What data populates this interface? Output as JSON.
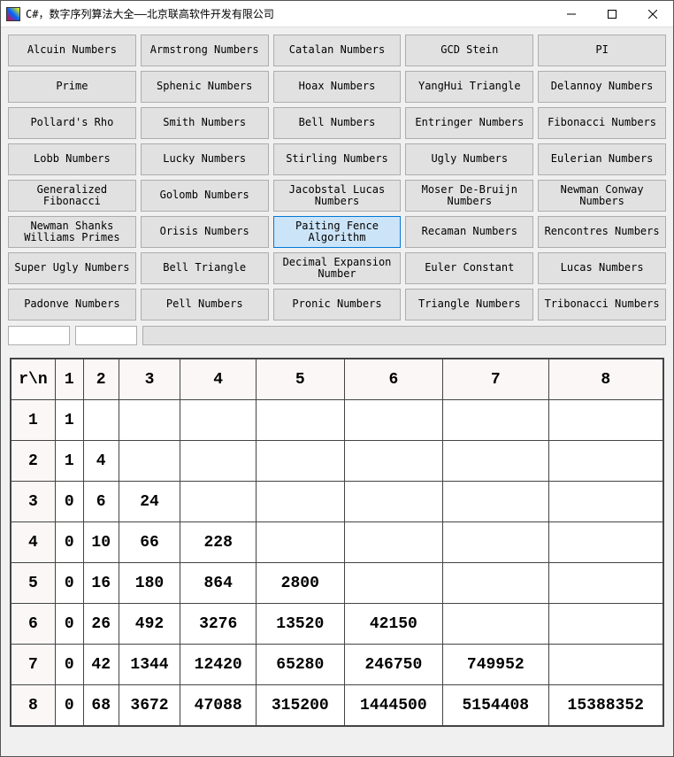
{
  "window": {
    "title": "C#，数字序列算法大全——北京联高软件开发有限公司"
  },
  "buttons": [
    "Alcuin Numbers",
    "Armstrong Numbers",
    "Catalan Numbers",
    "GCD Stein",
    "PI",
    "Prime",
    "Sphenic Numbers",
    "Hoax Numbers",
    "YangHui Triangle",
    "Delannoy Numbers",
    "Pollard's Rho",
    "Smith Numbers",
    "Bell Numbers",
    "Entringer Numbers",
    "Fibonacci Numbers",
    "Lobb Numbers",
    "Lucky Numbers",
    "Stirling Numbers",
    "Ugly Numbers",
    "Eulerian Numbers",
    "Generalized Fibonacci",
    "Golomb Numbers",
    "Jacobstal Lucas Numbers",
    "Moser De-Bruijn Numbers",
    "Newman Conway Numbers",
    "Newman Shanks Williams Primes",
    "Orisis Numbers",
    "Paiting Fence Algorithm",
    "Recaman Numbers",
    "Rencontres Numbers",
    "Super Ugly Numbers",
    "Bell Triangle",
    "Decimal Expansion Number",
    "Euler Constant",
    "Lucas Numbers",
    "Padonve Numbers",
    "Pell Numbers",
    "Pronic Numbers",
    "Triangle Numbers",
    "Tribonacci Numbers"
  ],
  "selected_button_index": 27,
  "inputs": {
    "a": "",
    "b": ""
  },
  "table": {
    "corner": "r\\n",
    "headers": [
      "1",
      "2",
      "3",
      "4",
      "5",
      "6",
      "7",
      "8"
    ],
    "rows": [
      {
        "r": "1",
        "c": [
          "1",
          "",
          "",
          "",
          "",
          "",
          "",
          ""
        ]
      },
      {
        "r": "2",
        "c": [
          "1",
          "4",
          "",
          "",
          "",
          "",
          "",
          ""
        ]
      },
      {
        "r": "3",
        "c": [
          "0",
          "6",
          "24",
          "",
          "",
          "",
          "",
          ""
        ]
      },
      {
        "r": "4",
        "c": [
          "0",
          "10",
          "66",
          "228",
          "",
          "",
          "",
          ""
        ]
      },
      {
        "r": "5",
        "c": [
          "0",
          "16",
          "180",
          "864",
          "2800",
          "",
          "",
          ""
        ]
      },
      {
        "r": "6",
        "c": [
          "0",
          "26",
          "492",
          "3276",
          "13520",
          "42150",
          "",
          ""
        ]
      },
      {
        "r": "7",
        "c": [
          "0",
          "42",
          "1344",
          "12420",
          "65280",
          "246750",
          "749952",
          ""
        ]
      },
      {
        "r": "8",
        "c": [
          "0",
          "68",
          "3672",
          "47088",
          "315200",
          "1444500",
          "5154408",
          "15388352"
        ]
      }
    ]
  },
  "chart_data": {
    "type": "table",
    "title": "Paiting Fence Algorithm r\\n",
    "headers": [
      "r\\n",
      "1",
      "2",
      "3",
      "4",
      "5",
      "6",
      "7",
      "8"
    ],
    "rows": [
      [
        "1",
        1,
        null,
        null,
        null,
        null,
        null,
        null,
        null
      ],
      [
        "2",
        1,
        4,
        null,
        null,
        null,
        null,
        null,
        null
      ],
      [
        "3",
        0,
        6,
        24,
        null,
        null,
        null,
        null,
        null
      ],
      [
        "4",
        0,
        10,
        66,
        228,
        null,
        null,
        null,
        null
      ],
      [
        "5",
        0,
        16,
        180,
        864,
        2800,
        null,
        null,
        null
      ],
      [
        "6",
        0,
        26,
        492,
        3276,
        13520,
        42150,
        null,
        null
      ],
      [
        "7",
        0,
        42,
        1344,
        12420,
        65280,
        246750,
        749952,
        null
      ],
      [
        "8",
        0,
        68,
        3672,
        47088,
        315200,
        1444500,
        5154408,
        15388352
      ]
    ]
  }
}
